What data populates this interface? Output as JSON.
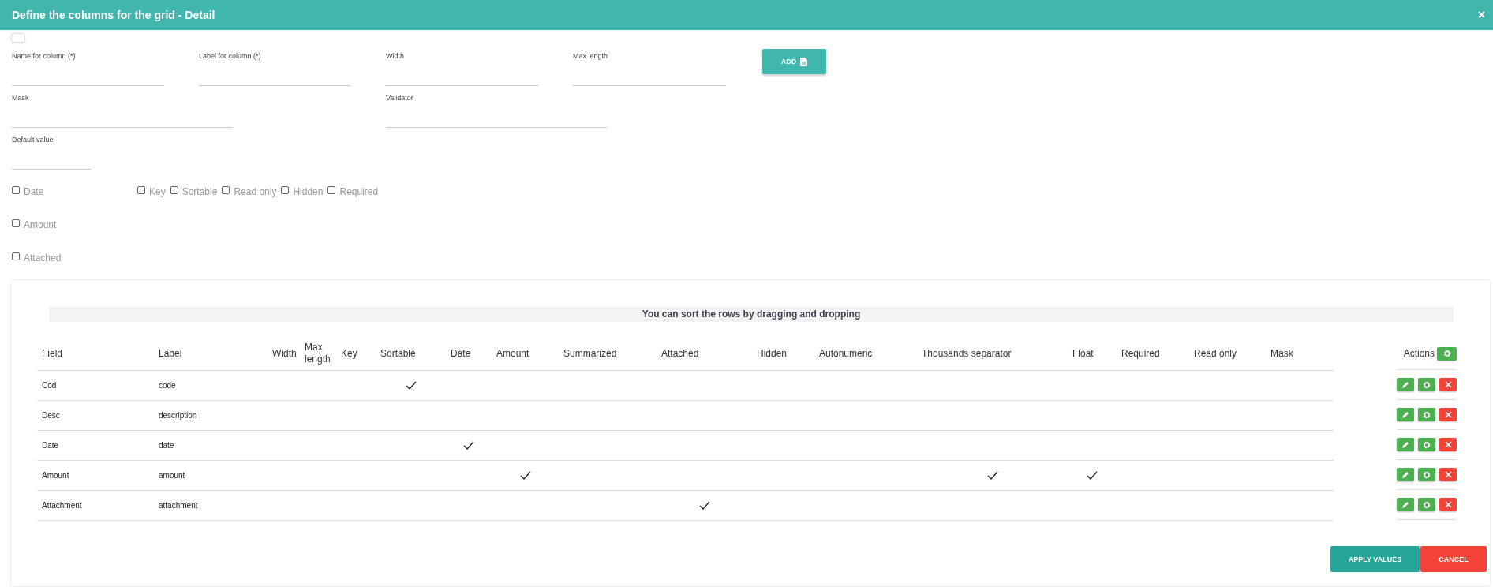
{
  "window": {
    "title": "Define the columns for the grid - Detail",
    "close": "×"
  },
  "toggle": {
    "on": false
  },
  "form": {
    "field_rows": [
      [
        {
          "label": "Name for column (*)"
        },
        {
          "label": "Label for column (*)"
        },
        {
          "label": "Width"
        },
        {
          "label": "Max length"
        }
      ],
      [
        {
          "label": "Mask"
        },
        {
          "label": "Validator"
        }
      ],
      [
        {
          "label": "Default value"
        }
      ]
    ],
    "add_button": "ADD",
    "type_checkboxes": [
      {
        "label": "Date",
        "checked": false
      },
      {
        "label": "Amount",
        "checked": false
      },
      {
        "label": "Attached",
        "checked": false
      }
    ],
    "option_checkboxes": [
      {
        "label": "Key",
        "checked": false
      },
      {
        "label": "Sortable",
        "checked": false
      },
      {
        "label": "Read only",
        "checked": false
      },
      {
        "label": "Hidden",
        "checked": false
      },
      {
        "label": "Required",
        "checked": false
      }
    ]
  },
  "grid": {
    "hint": "You can sort the rows by dragging and dropping",
    "columns": [
      {
        "label": "Field",
        "kind": "field"
      },
      {
        "label": "Label",
        "kind": "label"
      },
      {
        "label": "Width",
        "kind": "blank"
      },
      {
        "label": "Max length",
        "kind": "blank"
      },
      {
        "label": "Key",
        "kind": "check"
      },
      {
        "label": "Sortable",
        "kind": "check"
      },
      {
        "label": "Date",
        "kind": "check"
      },
      {
        "label": "Amount",
        "kind": "check"
      },
      {
        "label": "Summarized",
        "kind": "check"
      },
      {
        "label": "Attached",
        "kind": "check"
      },
      {
        "label": "Hidden",
        "kind": "check"
      },
      {
        "label": "Autonumeric",
        "kind": "check"
      },
      {
        "label": "Thousands separator",
        "kind": "check"
      },
      {
        "label": "Float",
        "kind": "check"
      },
      {
        "label": "Required",
        "kind": "check"
      },
      {
        "label": "Read only",
        "kind": "check"
      },
      {
        "label": "Mask",
        "kind": "blank"
      }
    ],
    "actions_label": "Actions",
    "rows": [
      {
        "field": "Cod",
        "label": "code",
        "checks": [
          false,
          true,
          false,
          false,
          false,
          false,
          false,
          false,
          false,
          false,
          false,
          false
        ]
      },
      {
        "field": "Desc",
        "label": "description",
        "checks": [
          false,
          false,
          false,
          false,
          false,
          false,
          false,
          false,
          false,
          false,
          false,
          false
        ]
      },
      {
        "field": "Date",
        "label": "date",
        "checks": [
          false,
          false,
          true,
          false,
          false,
          false,
          false,
          false,
          false,
          false,
          false,
          false
        ]
      },
      {
        "field": "Amount",
        "label": "amount",
        "checks": [
          false,
          false,
          false,
          true,
          false,
          false,
          false,
          false,
          true,
          true,
          false,
          false
        ]
      },
      {
        "field": "Attachment",
        "label": "attachment",
        "checks": [
          false,
          false,
          false,
          false,
          false,
          true,
          false,
          false,
          false,
          false,
          false,
          false
        ]
      }
    ]
  },
  "footer": {
    "apply": "APPLY VALUES",
    "cancel": "CANCEL"
  }
}
